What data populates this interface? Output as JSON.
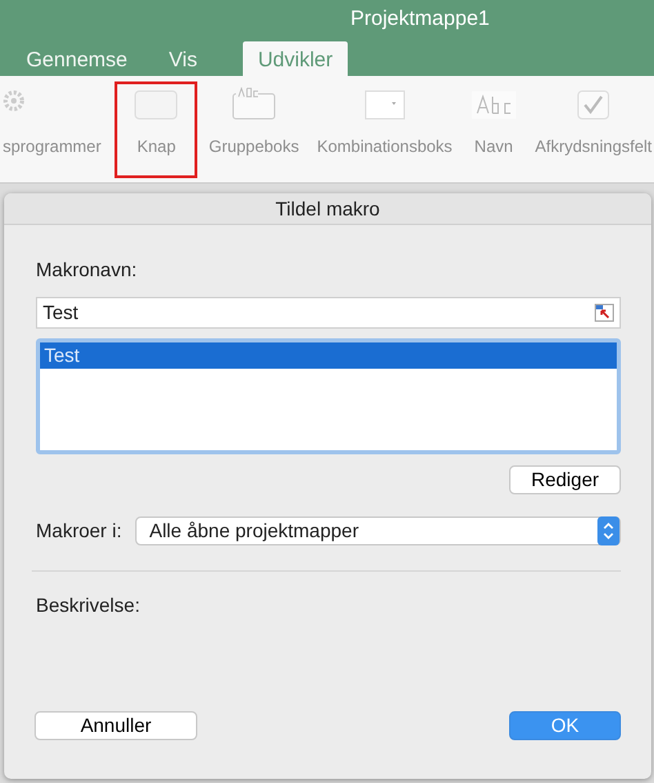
{
  "window": {
    "title": "Projektmappe1"
  },
  "tabs": [
    {
      "label": "Gennemse",
      "selected": false
    },
    {
      "label": "Vis",
      "selected": false
    },
    {
      "label": "Udvikler",
      "selected": true
    }
  ],
  "ribbon": {
    "items": [
      {
        "kind": "gear",
        "label": "sprogrammer",
        "highlighted": false
      },
      {
        "kind": "button",
        "label": "Knap",
        "highlighted": true
      },
      {
        "kind": "groupbox",
        "label": "Gruppeboks",
        "highlighted": false
      },
      {
        "kind": "combobox",
        "label": "Kombinationsboks",
        "highlighted": false
      },
      {
        "kind": "label",
        "label": "Navn",
        "highlighted": false
      },
      {
        "kind": "checkbox",
        "label": "Afkrydsningsfelt",
        "highlighted": false
      }
    ]
  },
  "dialog": {
    "title": "Tildel makro",
    "macro_name_label": "Makronavn:",
    "macro_name_value": "Test",
    "macros": [
      {
        "label": "Test",
        "selected": true
      }
    ],
    "edit_button": "Rediger",
    "macros_in_label": "Makroer i:",
    "macros_in_value": "Alle åbne projektmapper",
    "description_label": "Beskrivelse:",
    "cancel_button": "Annuller",
    "ok_button": "OK"
  }
}
